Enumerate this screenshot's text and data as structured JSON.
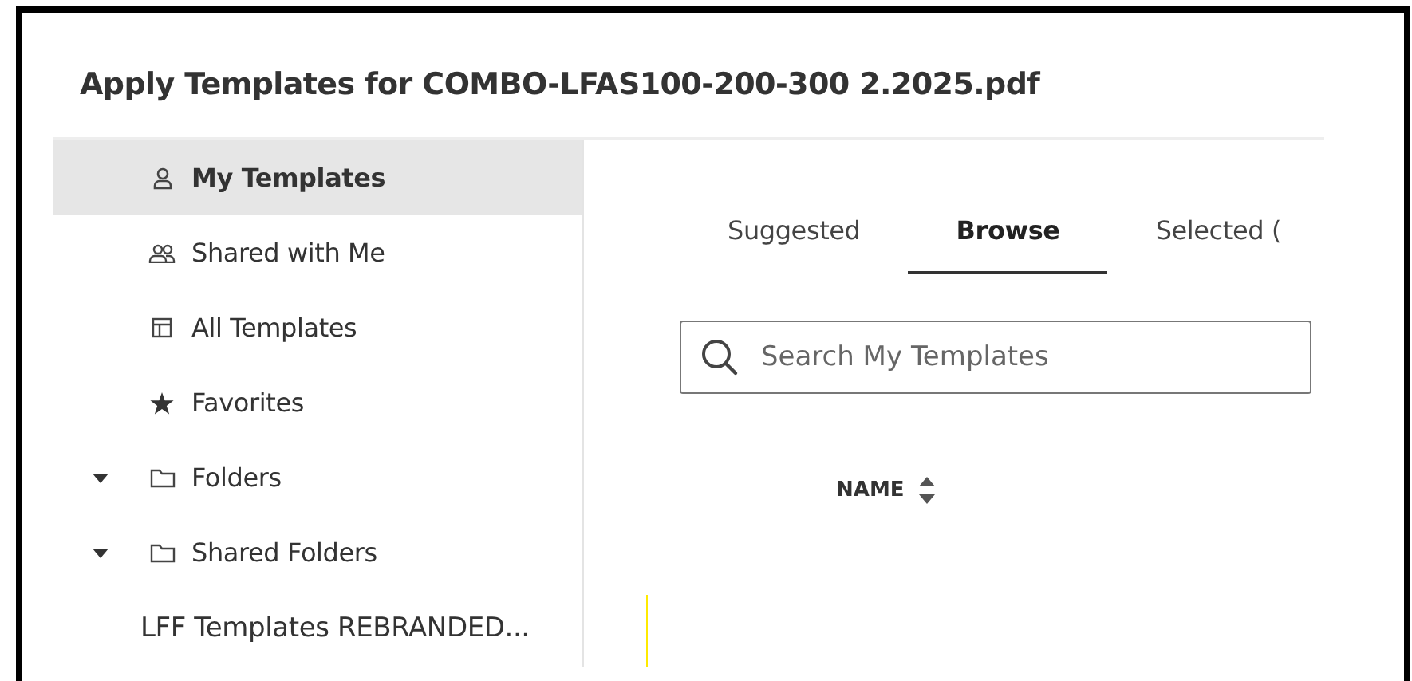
{
  "dialog": {
    "title": "Apply Templates for COMBO-LFAS100-200-300 2.2025.pdf"
  },
  "sidebar": {
    "items": [
      {
        "label": "My Templates",
        "kind": "user",
        "selected": true
      },
      {
        "label": "Shared with Me",
        "kind": "users",
        "selected": false
      },
      {
        "label": "All Templates",
        "kind": "layout",
        "selected": false
      },
      {
        "label": "Favorites",
        "kind": "star",
        "selected": false
      },
      {
        "label": "Folders",
        "kind": "folder",
        "selected": false,
        "expanded": true
      },
      {
        "label": "Shared Folders",
        "kind": "folder",
        "selected": false,
        "expanded": true,
        "children": [
          {
            "label": "LFF Templates REBRANDED...",
            "selected": false
          }
        ]
      }
    ]
  },
  "tabs": [
    {
      "label": "Suggested",
      "selected": false
    },
    {
      "label": "Browse",
      "selected": true
    },
    {
      "label": "Selected (",
      "selected": false
    }
  ],
  "search": {
    "placeholder": "Search My Templates"
  },
  "table": {
    "columns": [
      {
        "label": "NAME",
        "sortable": true
      }
    ]
  }
}
